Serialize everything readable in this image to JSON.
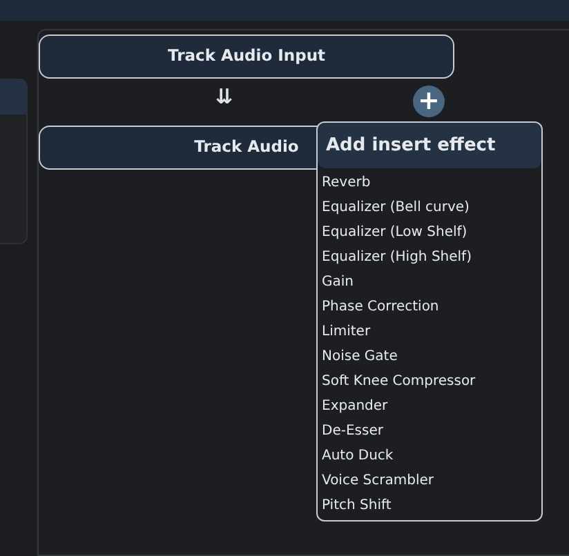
{
  "chain": {
    "input_label": "Track Audio Input",
    "flow_arrow": "⇊",
    "add_button": "+",
    "track_label": "Track Audio"
  },
  "menu": {
    "title": "Add insert effect",
    "items": [
      {
        "label": "Reverb"
      },
      {
        "label": "Equalizer (Bell curve)"
      },
      {
        "label": "Equalizer (Low Shelf)"
      },
      {
        "label": "Equalizer (High Shelf)"
      },
      {
        "label": "Gain"
      },
      {
        "label": "Phase Correction"
      },
      {
        "label": "Limiter"
      },
      {
        "label": "Noise Gate"
      },
      {
        "label": "Soft Knee Compressor"
      },
      {
        "label": "Expander"
      },
      {
        "label": "De-Esser"
      },
      {
        "label": "Auto Duck"
      },
      {
        "label": "Voice Scrambler"
      },
      {
        "label": "Pitch Shift"
      }
    ]
  }
}
